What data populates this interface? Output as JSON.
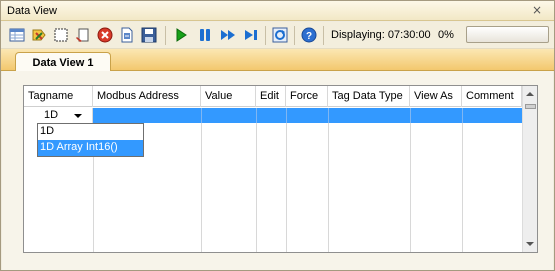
{
  "window": {
    "title": "Data View",
    "close_glyph": "×"
  },
  "toolbar": {
    "buttons": [
      {
        "name": "data-view-icon"
      },
      {
        "name": "add-tags-icon"
      },
      {
        "name": "select-icon"
      },
      {
        "name": "clear-icon"
      },
      {
        "name": "delete-icon"
      },
      {
        "name": "export-icon"
      },
      {
        "name": "save-icon"
      },
      {
        "name": "play-icon"
      },
      {
        "name": "pause-icon"
      },
      {
        "name": "fast-forward-icon"
      },
      {
        "name": "step-forward-icon"
      },
      {
        "name": "refresh-screen-icon"
      },
      {
        "name": "help-icon"
      }
    ],
    "displaying": "Displaying: 07:30:00",
    "percent": "0%",
    "progress_value": 0
  },
  "tabs": [
    {
      "label": "Data View 1",
      "active": true
    }
  ],
  "table": {
    "columns": [
      "Tagname",
      "Modbus Address",
      "Value",
      "Edit",
      "Force",
      "Tag Data Type",
      "View As",
      "Comment"
    ],
    "editing_value": "1D",
    "dropdown_options": [
      "1D",
      "1D Array Int16()"
    ],
    "dropdown_selected_index": 1
  },
  "colors": {
    "selection": "#3399ff",
    "tab_strip": "#f3c86e",
    "play_green": "#18a018"
  }
}
